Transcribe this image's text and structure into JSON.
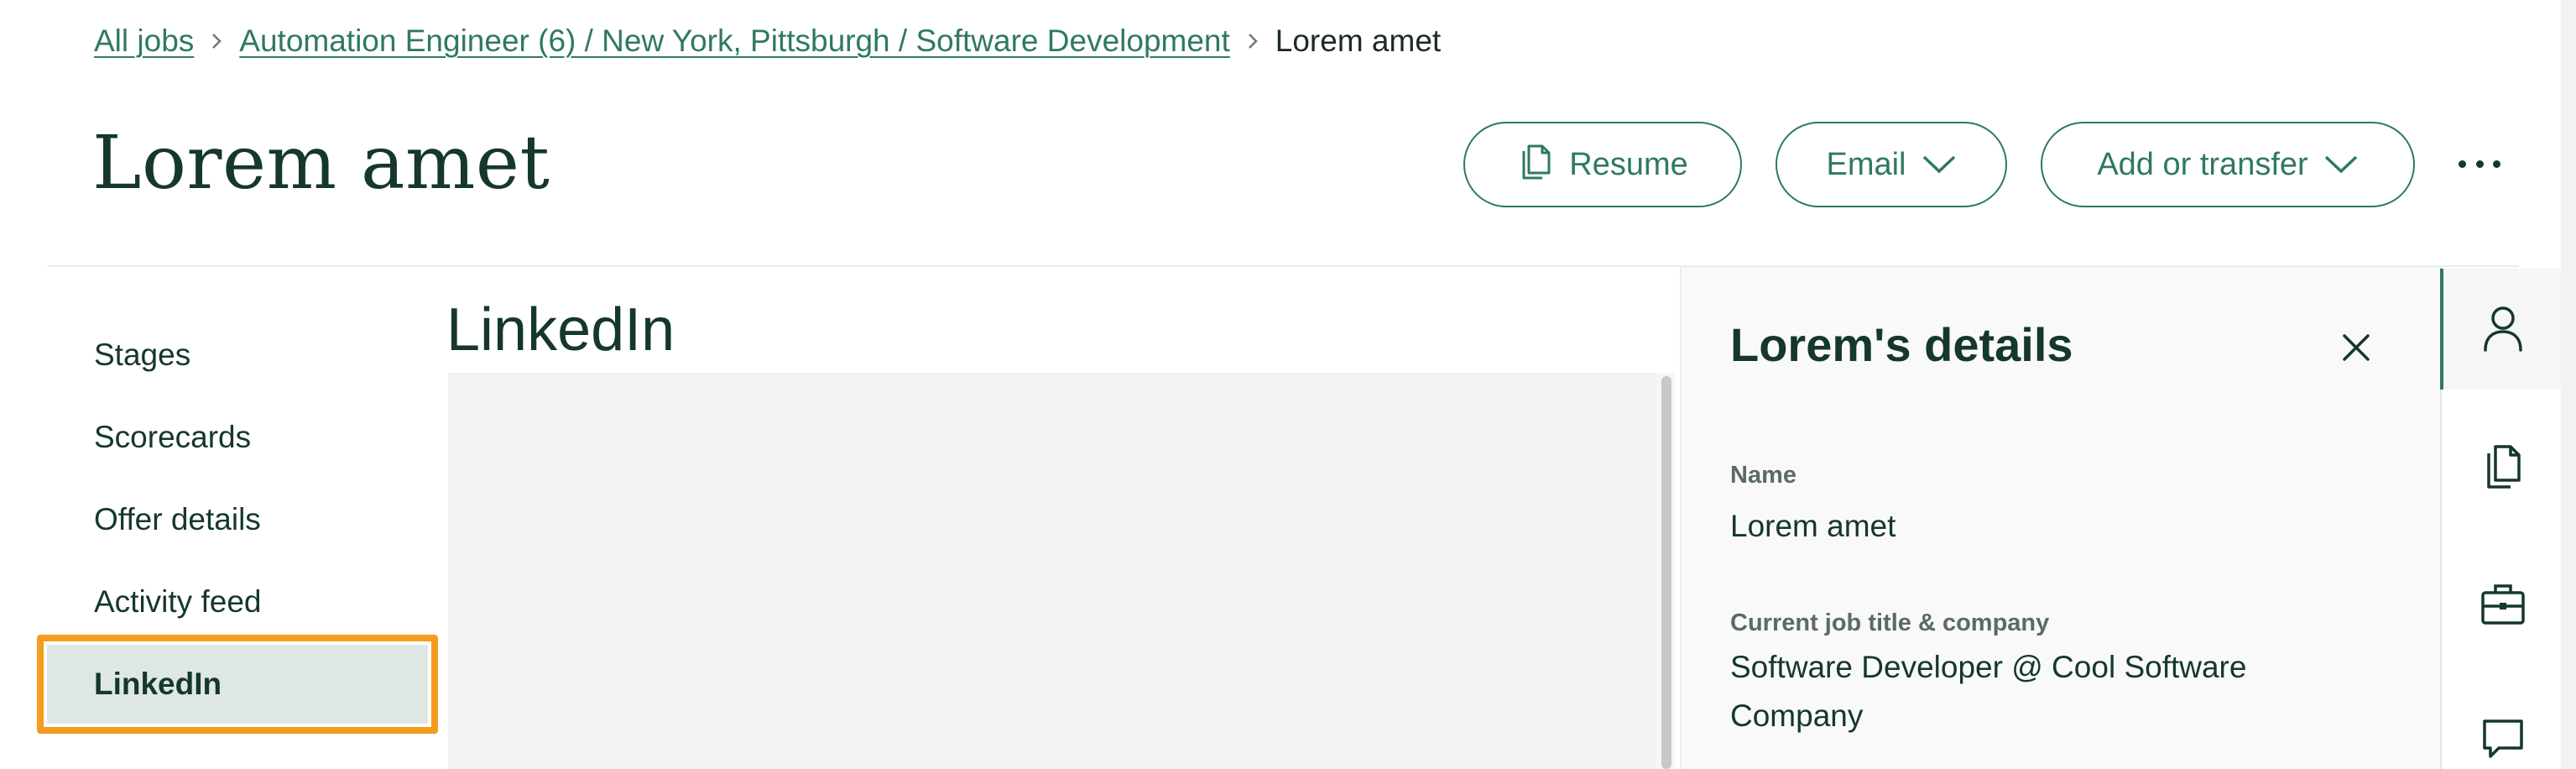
{
  "breadcrumb": {
    "all_jobs": "All jobs",
    "job": "Automation Engineer (6) / New York, Pittsburgh / Software Development",
    "current": "Lorem amet"
  },
  "header": {
    "title": "Lorem amet",
    "buttons": {
      "resume": "Resume",
      "email": "Email",
      "add_transfer": "Add or transfer"
    }
  },
  "sidebar": {
    "items": [
      {
        "label": "Stages"
      },
      {
        "label": "Scorecards"
      },
      {
        "label": "Offer details"
      },
      {
        "label": "Activity feed"
      },
      {
        "label": "LinkedIn",
        "selected": true
      }
    ]
  },
  "main": {
    "heading": "LinkedIn"
  },
  "details": {
    "title": "Lorem's details",
    "fields": [
      {
        "label": "Name",
        "value": "Lorem amet"
      },
      {
        "label": "Current job title & company",
        "value": "Software Developer @ Cool Software Company"
      }
    ]
  },
  "rail": {
    "icons": [
      "person-icon",
      "documents-icon",
      "briefcase-icon",
      "chat-icon"
    ],
    "active": "person-icon"
  },
  "colors": {
    "accent": "#2f7a5c",
    "text": "#15372c",
    "highlight_outline": "#f39c1f",
    "selected_bg": "#dfe7e3"
  }
}
